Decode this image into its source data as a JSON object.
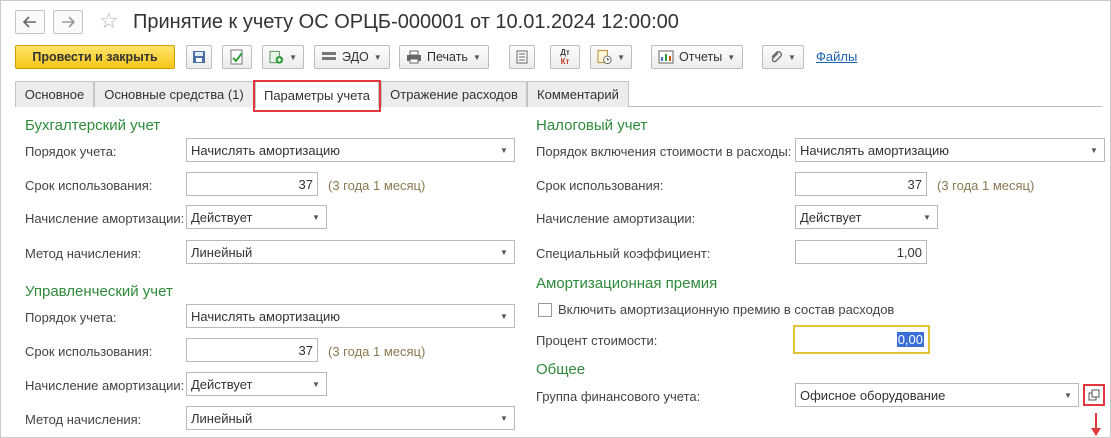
{
  "window": {
    "title": "Принятие к учету ОС ОРЦБ-000001 от 10.01.2024 12:00:00",
    "nav": {
      "back_icon": "arrow-left-icon",
      "forward_icon": "arrow-right-icon"
    }
  },
  "toolbar": {
    "post_close": "Провести и закрыть",
    "edo": "ЭДО",
    "print": "Печать",
    "reports": "Отчеты",
    "files_link": "Файлы",
    "dt_kt_top": "Дт",
    "dt_kt_bottom": "Кт"
  },
  "tabs": [
    {
      "label": "Основное"
    },
    {
      "label": "Основные средства (1)"
    },
    {
      "label": "Параметры учета",
      "active": true
    },
    {
      "label": "Отражение расходов"
    },
    {
      "label": "Комментарий"
    }
  ],
  "accounting": {
    "title": "Бухгалтерский учет",
    "order_label": "Порядок учета:",
    "order_value": "Начислять амортизацию",
    "term_label": "Срок использования:",
    "term_value": "37",
    "term_hint": "(3 года 1 месяц)",
    "depr_label": "Начисление амортизации:",
    "depr_value": "Действует",
    "method_label": "Метод начисления:",
    "method_value": "Линейный"
  },
  "management": {
    "title": "Управленческий учет",
    "order_label": "Порядок учета:",
    "order_value": "Начислять амортизацию",
    "term_label": "Срок использования:",
    "term_value": "37",
    "term_hint": "(3 года 1 месяц)",
    "depr_label": "Начисление амортизации:",
    "depr_value": "Действует",
    "method_label": "Метод начисления:",
    "method_value": "Линейный"
  },
  "tax": {
    "title": "Налоговый учет",
    "order_label": "Порядок включения стоимости в расходы:",
    "order_value": "Начислять амортизацию",
    "term_label": "Срок использования:",
    "term_value": "37",
    "term_hint": "(3 года 1 месяц)",
    "depr_label": "Начисление амортизации:",
    "depr_value": "Действует",
    "coef_label": "Специальный коэффициент:",
    "coef_value": "1,00"
  },
  "premium": {
    "title": "Амортизационная премия",
    "include_label": "Включить амортизационную премию в состав расходов",
    "include_checked": false,
    "percent_label": "Процент стоимости:",
    "percent_value": "0,00"
  },
  "general": {
    "title": "Общее",
    "group_label": "Группа финансового учета:",
    "group_value": "Офисное оборудование"
  },
  "colors": {
    "accent_yellow": "#f5c518",
    "section_green": "#2e8b3a",
    "highlight_red": "#e0383e",
    "link_blue": "#1a5fb4"
  }
}
